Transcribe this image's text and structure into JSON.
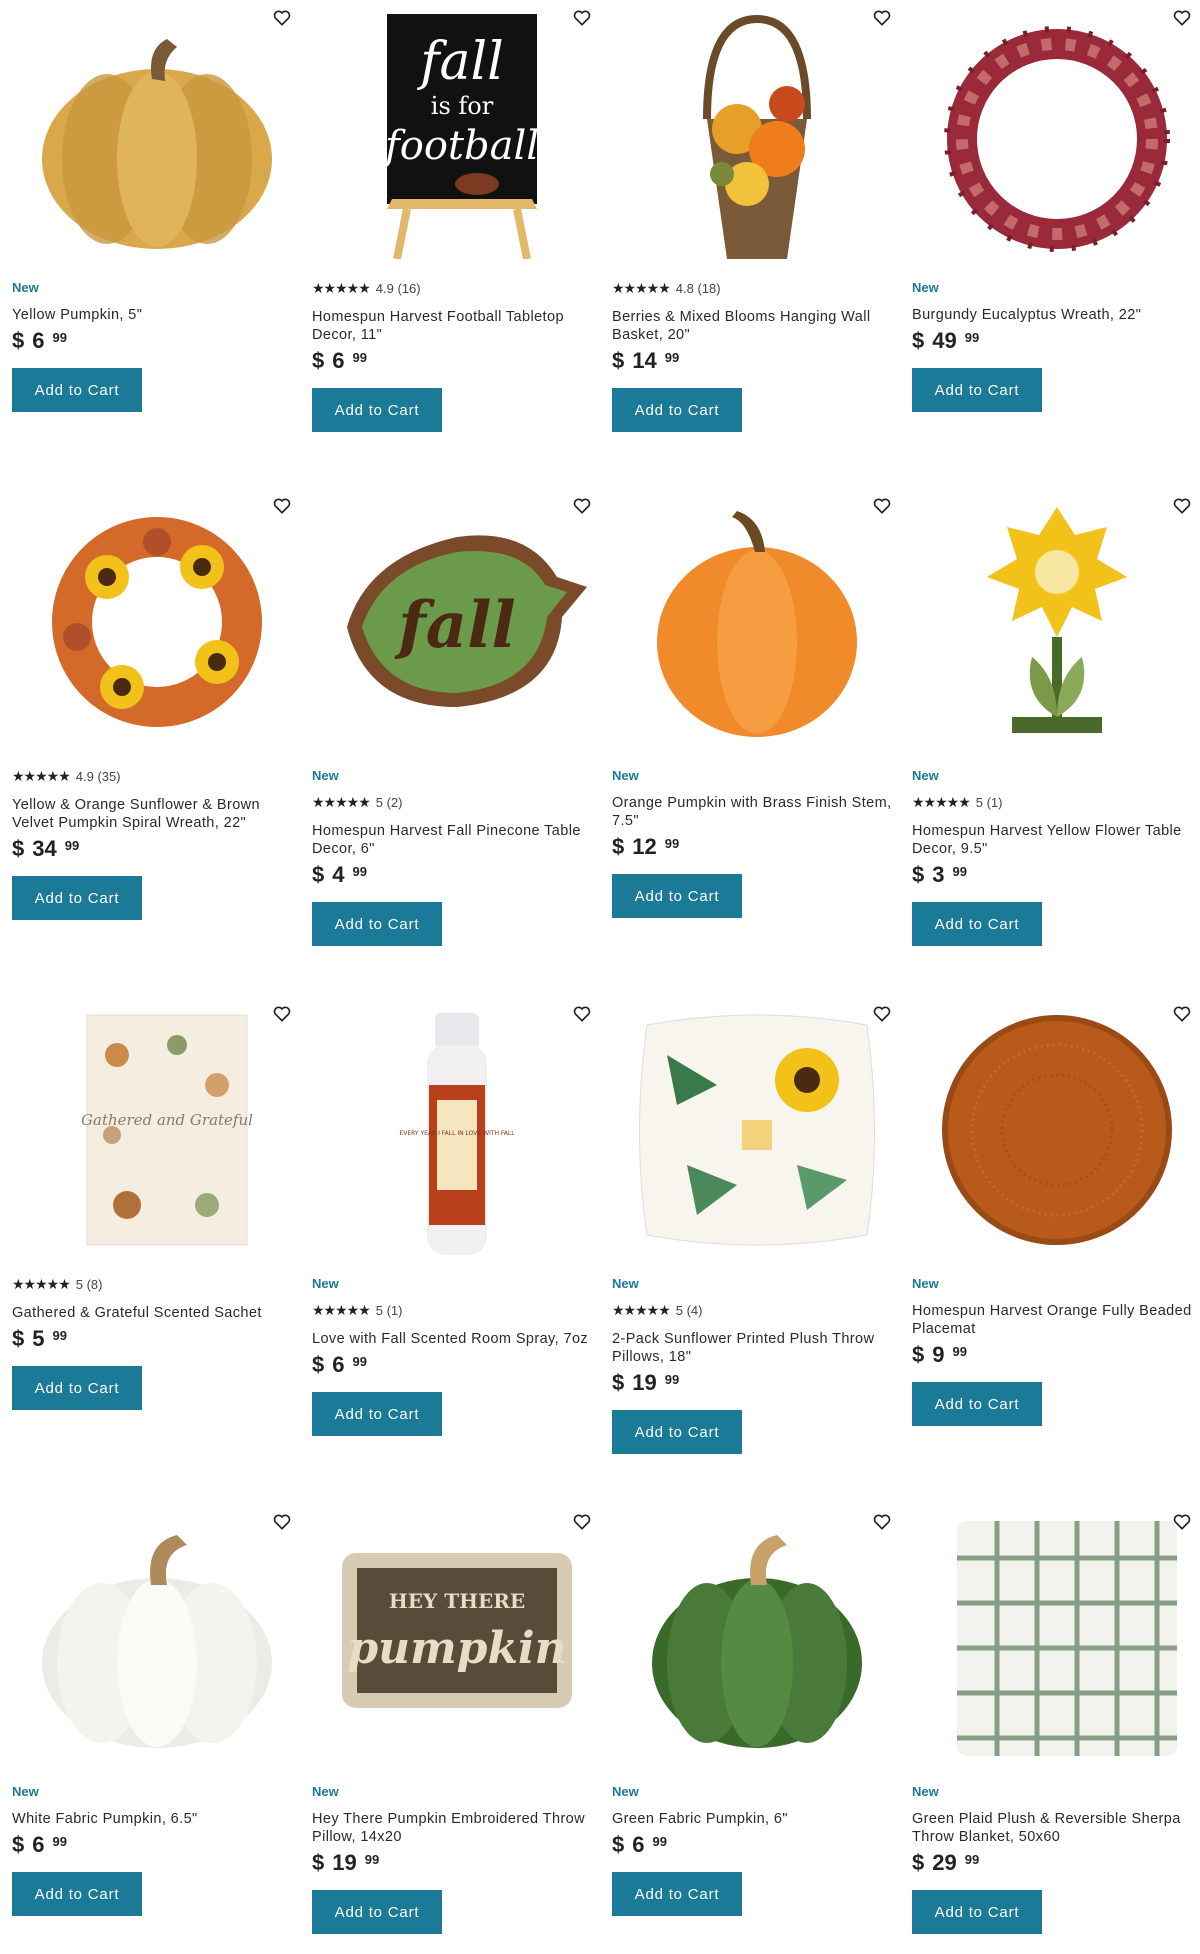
{
  "colors": {
    "accent": "#1a7a98",
    "text": "#222222"
  },
  "products": [
    {
      "badge": "New",
      "stars": "",
      "rating": "",
      "name": "Yellow Pumpkin, 5\"",
      "dollars": "6",
      "cents": "99",
      "cta": "Add to Cart"
    },
    {
      "badge": "",
      "stars": "★★★★★",
      "rating": "4.9 (16)",
      "name": "Homespun Harvest Football Tabletop Decor, 11\"",
      "dollars": "6",
      "cents": "99",
      "cta": "Add to Cart"
    },
    {
      "badge": "",
      "stars": "★★★★★",
      "rating": "4.8 (18)",
      "name": "Berries & Mixed Blooms Hanging Wall Basket, 20\"",
      "dollars": "14",
      "cents": "99",
      "cta": "Add to Cart"
    },
    {
      "badge": "New",
      "stars": "",
      "rating": "",
      "name": "Burgundy Eucalyptus Wreath, 22\"",
      "dollars": "49",
      "cents": "99",
      "cta": "Add to Cart"
    },
    {
      "badge": "",
      "stars": "★★★★★",
      "rating": "4.9 (35)",
      "name": "Yellow & Orange Sunflower & Brown Velvet Pumpkin Spiral Wreath, 22\"",
      "dollars": "34",
      "cents": "99",
      "cta": "Add to Cart"
    },
    {
      "badge": "New",
      "stars": "★★★★★",
      "rating": "5 (2)",
      "name": "Homespun Harvest Fall Pinecone Table Decor, 6\"",
      "dollars": "4",
      "cents": "99",
      "cta": "Add to Cart"
    },
    {
      "badge": "New",
      "stars": "",
      "rating": "",
      "name": "Orange Pumpkin with Brass Finish Stem, 7.5\"",
      "dollars": "12",
      "cents": "99",
      "cta": "Add to Cart"
    },
    {
      "badge": "New",
      "stars": "★★★★★",
      "rating": "5 (1)",
      "name": "Homespun Harvest Yellow Flower Table Decor, 9.5\"",
      "dollars": "3",
      "cents": "99",
      "cta": "Add to Cart"
    },
    {
      "badge": "",
      "stars": "★★★★★",
      "rating": "5 (8)",
      "name": "Gathered & Grateful Scented Sachet",
      "dollars": "5",
      "cents": "99",
      "cta": "Add to Cart"
    },
    {
      "badge": "New",
      "stars": "★★★★★",
      "rating": "5 (1)",
      "name": "Love with Fall Scented Room Spray, 7oz",
      "dollars": "6",
      "cents": "99",
      "cta": "Add to Cart"
    },
    {
      "badge": "New",
      "stars": "★★★★★",
      "rating": "5 (4)",
      "name": "2-Pack Sunflower Printed Plush Throw Pillows, 18\"",
      "dollars": "19",
      "cents": "99",
      "cta": "Add to Cart"
    },
    {
      "badge": "New",
      "stars": "",
      "rating": "",
      "name": "Homespun Harvest Orange Fully Beaded Placemat",
      "dollars": "9",
      "cents": "99",
      "cta": "Add to Cart"
    },
    {
      "badge": "New",
      "stars": "",
      "rating": "",
      "name": "White Fabric Pumpkin, 6.5\"",
      "dollars": "6",
      "cents": "99",
      "cta": "Add to Cart"
    },
    {
      "badge": "New",
      "stars": "",
      "rating": "",
      "name": "Hey There Pumpkin Embroidered Throw Pillow, 14x20",
      "dollars": "19",
      "cents": "99",
      "cta": "Add to Cart"
    },
    {
      "badge": "New",
      "stars": "",
      "rating": "",
      "name": "Green Fabric Pumpkin, 6\"",
      "dollars": "6",
      "cents": "99",
      "cta": "Add to Cart"
    },
    {
      "badge": "New",
      "stars": "",
      "rating": "",
      "name": "Green Plaid Plush & Reversible Sherpa Throw Blanket, 50x60",
      "dollars": "29",
      "cents": "99",
      "cta": "Add to Cart"
    }
  ],
  "currency_symbol": "$",
  "images": {
    "sign_line1": "fall",
    "sign_line2": "is for",
    "sign_line3": "football",
    "leaf_text": "fall",
    "spray_text": "EVERY YEAR I FALL IN LOVE WITH FALL",
    "sachet_text": "Gathered and Grateful",
    "pillow_top": "HEY THERE",
    "pillow_main": "pumpkin"
  }
}
